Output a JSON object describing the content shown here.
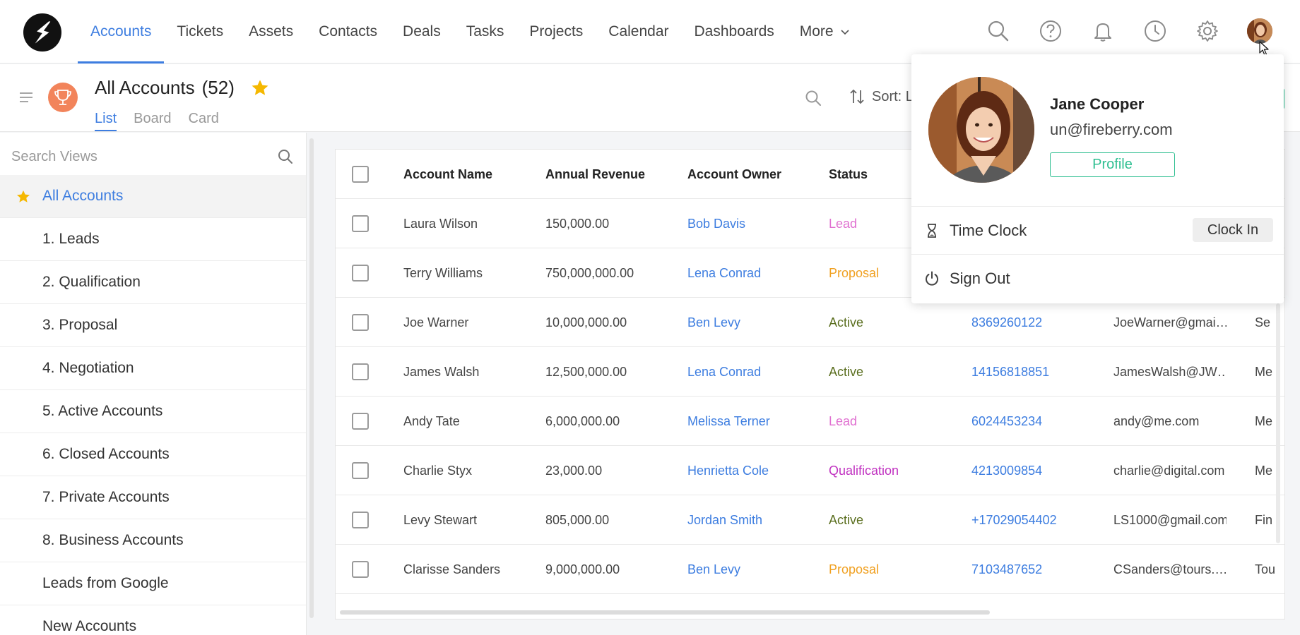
{
  "nav": {
    "items": [
      {
        "label": "Accounts",
        "active": true
      },
      {
        "label": "Tickets"
      },
      {
        "label": "Assets"
      },
      {
        "label": "Contacts"
      },
      {
        "label": "Deals"
      },
      {
        "label": "Tasks"
      },
      {
        "label": "Projects"
      },
      {
        "label": "Calendar"
      },
      {
        "label": "Dashboards"
      }
    ],
    "more_label": "More",
    "icons": [
      "search-icon",
      "help-icon",
      "bell-icon",
      "clock-icon",
      "gear-icon",
      "avatar"
    ]
  },
  "page": {
    "title": "All Accounts",
    "count": "(52)",
    "view_tabs": [
      "List",
      "Board",
      "Card"
    ],
    "sort_label": "Sort: L"
  },
  "sidebar": {
    "search_placeholder": "Search Views",
    "items": [
      "All Accounts",
      "1. Leads",
      "2. Qualification",
      "3. Proposal",
      "4. Negotiation",
      "5. Active Accounts",
      "6. Closed Accounts",
      "7. Private Accounts",
      "8. Business Accounts",
      "Leads from Google",
      "New Accounts"
    ]
  },
  "table": {
    "headers": [
      "Account Name",
      "Annual Revenue",
      "Account Owner",
      "Status"
    ],
    "rows": [
      {
        "name": "Laura Wilson",
        "revenue": "150,000.00",
        "owner": "Bob Davis",
        "status": "Lead",
        "phone": "",
        "email": "",
        "extra": ""
      },
      {
        "name": "Terry Williams",
        "revenue": "750,000,000.00",
        "owner": "Lena Conrad",
        "status": "Proposal",
        "phone": "",
        "email": "",
        "extra": ""
      },
      {
        "name": "Joe Warner",
        "revenue": "10,000,000.00",
        "owner": "Ben Levy",
        "status": "Active",
        "phone": "8369260122",
        "email": "JoeWarner@gmai…",
        "extra": "Se"
      },
      {
        "name": "James Walsh",
        "revenue": "12,500,000.00",
        "owner": "Lena Conrad",
        "status": "Active",
        "phone": "14156818851",
        "email": "JamesWalsh@JW…",
        "extra": "Me"
      },
      {
        "name": "Andy Tate",
        "revenue": "6,000,000.00",
        "owner": "Melissa Terner",
        "status": "Lead",
        "phone": "6024453234",
        "email": "andy@me.com",
        "extra": "Me"
      },
      {
        "name": "Charlie Styx",
        "revenue": "23,000.00",
        "owner": "Henrietta Cole",
        "status": "Qualification",
        "phone": "4213009854",
        "email": "charlie@digital.com",
        "extra": "Me"
      },
      {
        "name": "Levy Stewart",
        "revenue": "805,000.00",
        "owner": "Jordan Smith",
        "status": "Active",
        "phone": "+17029054402",
        "email": "LS1000@gmail.com",
        "extra": "Fin"
      },
      {
        "name": "Clarisse Sanders",
        "revenue": "9,000,000.00",
        "owner": "Ben Levy",
        "status": "Proposal",
        "phone": "7103487652",
        "email": "CSanders@tours.…",
        "extra": "Tou"
      }
    ]
  },
  "status_colors": {
    "Lead": "#e06fd0",
    "Proposal": "#f0a020",
    "Active": "#5a6e1e",
    "Qualification": "#c030c0"
  },
  "profile": {
    "name": "Jane Cooper",
    "email": "un@fireberry.com",
    "profile_button": "Profile",
    "time_clock_label": "Time Clock",
    "clock_in_button": "Clock In",
    "sign_out_label": "Sign Out"
  },
  "colors": {
    "accent": "#3d7de0",
    "green": "#2fbf91",
    "star": "#f5b800"
  }
}
